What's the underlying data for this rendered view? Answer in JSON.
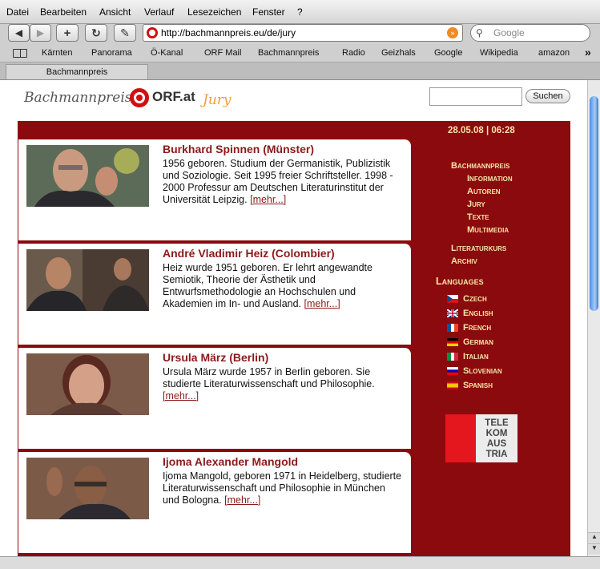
{
  "menu": [
    "Datei",
    "Bearbeiten",
    "Ansicht",
    "Verlauf",
    "Lesezeichen",
    "Fenster",
    "?"
  ],
  "toolbar": {
    "back": "◀",
    "forward": "▶",
    "add": "+",
    "reload": "↻",
    "edit": "✎",
    "url": "http://bachmannpreis.eu/de/jury",
    "search_placeholder": "Google"
  },
  "bookmarks": [
    "Kärnten",
    "Panorama",
    "Ö-Kanal",
    "ORF Mail",
    "Bachmannpreis",
    "Radio",
    "Geizhals",
    "Google",
    "Wikipedia",
    "amazon"
  ],
  "bookmarks_more": "»",
  "tab": {
    "title": "Bachmannpreis"
  },
  "site": {
    "logo": "Bachmannpreis",
    "logo_orf": "ORF.at",
    "section": "Jury",
    "search_button": "Suchen"
  },
  "jury": [
    {
      "name": "Burkhard Spinnen (Münster)",
      "bio": "1956 geboren. Studium der Germanistik, Publizistik und Soziologie. Seit 1995 freier Schriftsteller. 1998 - 2000 Professur am Deutschen Literaturinstitut der Universität Leipzig.",
      "more": "[mehr...]"
    },
    {
      "name": "André Vladimir Heiz (Colombier)",
      "bio": "Heiz wurde 1951 geboren. Er lehrt angewandte Semiotik, Theorie der Ästhetik und Entwurfsmethodologie an Hochschulen und Akademien im In- und Ausland.",
      "more": "[mehr...]"
    },
    {
      "name": "Ursula März (Berlin)",
      "bio": "Ursula März wurde 1957 in Berlin geboren. Sie studierte Literaturwissenschaft und Philosophie.",
      "more": "[mehr...]"
    },
    {
      "name": "Ijoma Alexander Mangold",
      "bio": "Ijoma Mangold, geboren 1971 in Heidelberg, studierte Literaturwissenschaft und Philosophie in München und Bologna.",
      "more": "[mehr...]"
    }
  ],
  "sidebar": {
    "datetime": "28.05.08 | 06:28",
    "nav_main": "Bachmannpreis",
    "nav_sub": [
      "Information",
      "Autoren",
      "Jury",
      "Texte",
      "Multimedia"
    ],
    "nav_other": [
      "Literaturkurs",
      "Archiv"
    ],
    "languages_title": "Languages",
    "languages": [
      "Czech",
      "English",
      "French",
      "German",
      "Italian",
      "Slovenian",
      "Spanish"
    ],
    "sponsor": "TELE KOM AUS TRIA"
  },
  "colors": {
    "brand_red": "#8b0a0d",
    "nav_text": "#f7e3a8",
    "name_text": "#8b1a1a",
    "jury_accent": "#f0a030"
  }
}
